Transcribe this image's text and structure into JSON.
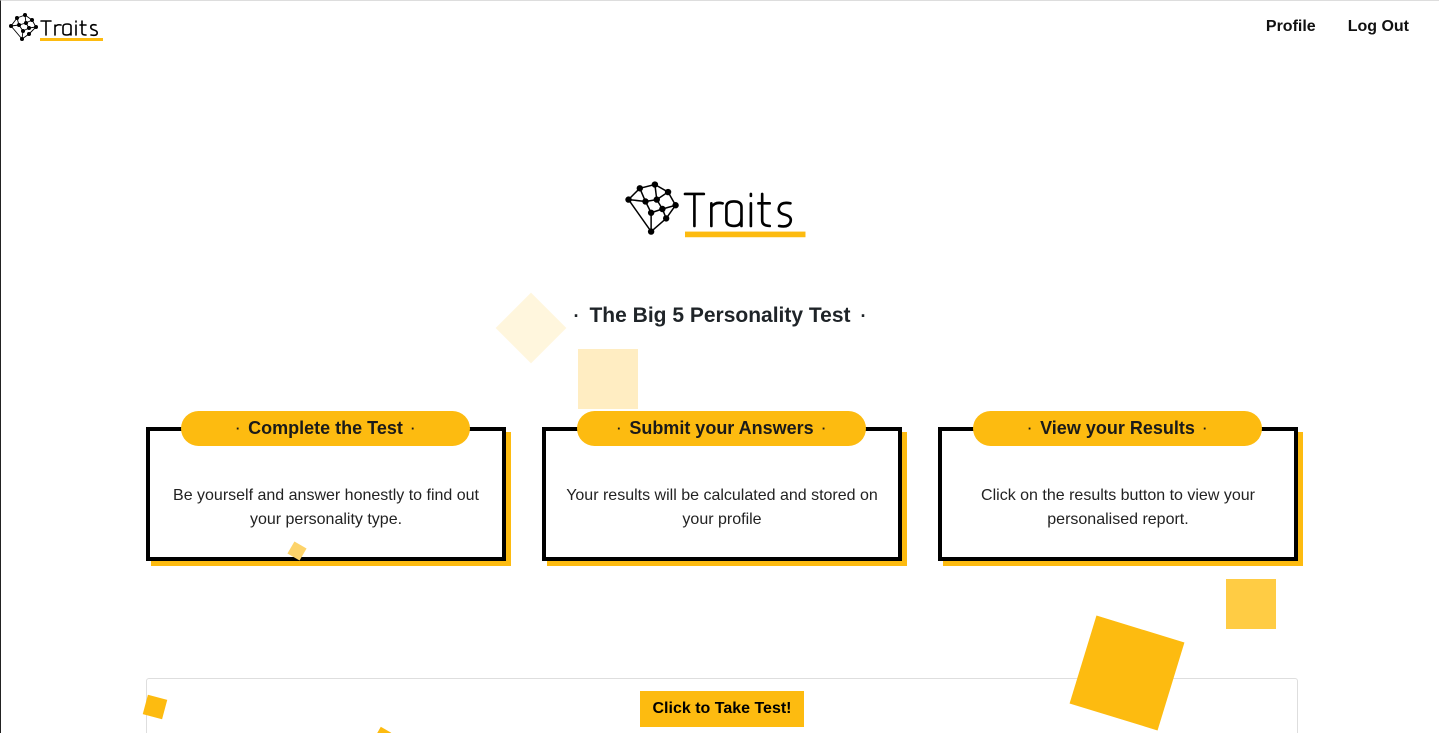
{
  "brand": {
    "logo_text": "Traits",
    "accent_color": "#fdbb10"
  },
  "nav": {
    "profile_label": "Profile",
    "logout_label": "Log Out"
  },
  "hero": {
    "title": "The Big 5 Personality Test",
    "title_dot": "·"
  },
  "steps": [
    {
      "title": "Complete the Test",
      "text": "Be yourself and answer honestly to find out your personality type."
    },
    {
      "title": "Submit your Answers",
      "text": "Your results will be calculated and stored on your profile"
    },
    {
      "title": "View your Results",
      "text": "Click on the results button to view your personalised report."
    }
  ],
  "cta": {
    "take_test_label": "Click to Take Test!"
  },
  "icons": {
    "logo_mark": "network-graph-icon"
  }
}
